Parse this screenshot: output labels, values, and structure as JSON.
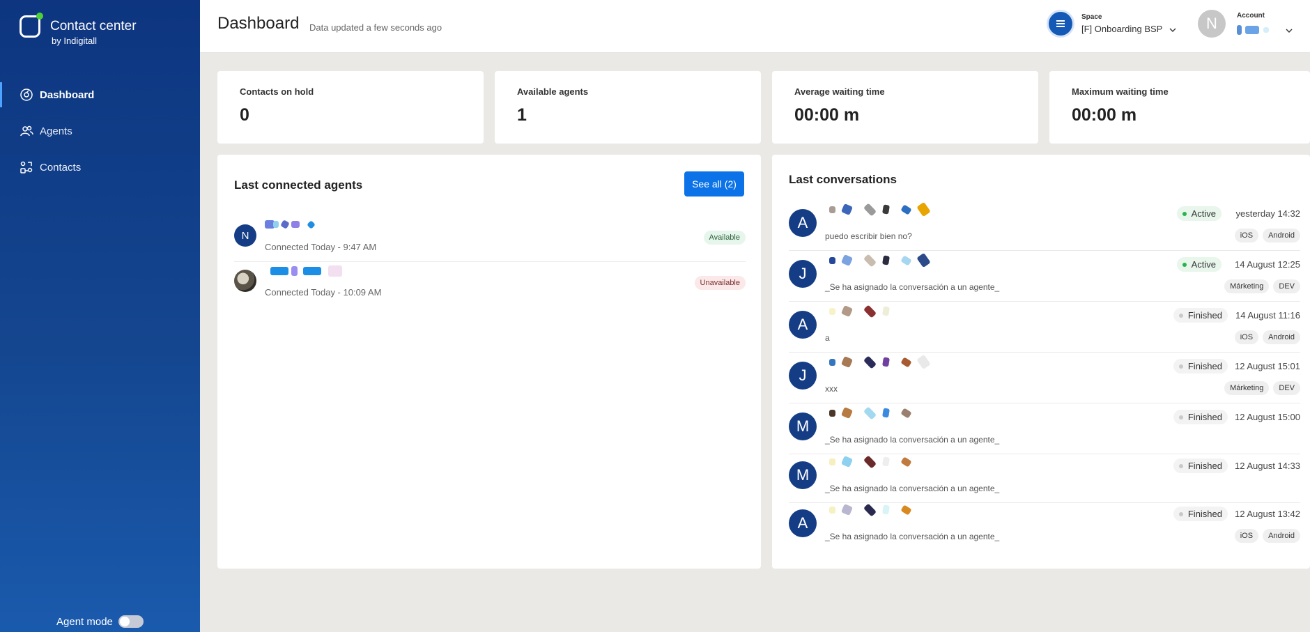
{
  "brand": {
    "title": "Contact center",
    "subtitle": "by Indigitall"
  },
  "nav": [
    {
      "label": "Dashboard",
      "icon": "dashboard-icon",
      "active": true
    },
    {
      "label": "Agents",
      "icon": "agents-icon",
      "active": false
    },
    {
      "label": "Contacts",
      "icon": "contacts-icon",
      "active": false
    }
  ],
  "agent_mode": {
    "label": "Agent mode",
    "enabled": false
  },
  "header": {
    "title": "Dashboard",
    "updated": "Data updated a few seconds ago",
    "space_label": "Space",
    "space_value": "[F] Onboarding BSP",
    "account_label": "Account",
    "account_initial": "N"
  },
  "stats": [
    {
      "label": "Contacts on hold",
      "value": "0"
    },
    {
      "label": "Available agents",
      "value": "1"
    },
    {
      "label": "Average waiting time",
      "value": "00:00 m"
    },
    {
      "label": "Maximum waiting time",
      "value": "00:00 m"
    }
  ],
  "agents_panel": {
    "title": "Last connected agents",
    "see_all": "See all (2)",
    "agents": [
      {
        "initial": "N",
        "connected": "Connected Today - 9:47 AM",
        "status": "Available"
      },
      {
        "initial": "",
        "connected": "Connected Today - 10:09 AM",
        "status": "Unavailable"
      }
    ]
  },
  "conversations_panel": {
    "title": "Last conversations",
    "items": [
      {
        "initial": "A",
        "message": "puedo escribir bien no?",
        "status": "Active",
        "time": "yesterday 14:32",
        "tags": [
          "iOS",
          "Android"
        ]
      },
      {
        "initial": "J",
        "message": "_Se ha asignado la conversación a un agente_",
        "status": "Active",
        "time": "14 August 12:25",
        "tags": [
          "Márketing",
          "DEV"
        ]
      },
      {
        "initial": "A",
        "message": "a",
        "status": "Finished",
        "time": "14 August 11:16",
        "tags": [
          "iOS",
          "Android"
        ]
      },
      {
        "initial": "J",
        "message": "xxx",
        "status": "Finished",
        "time": "12 August 15:01",
        "tags": [
          "Márketing",
          "DEV"
        ]
      },
      {
        "initial": "M",
        "message": "_Se ha asignado la conversación a un agente_",
        "status": "Finished",
        "time": "12 August 15:00",
        "tags": []
      },
      {
        "initial": "M",
        "message": "_Se ha asignado la conversación a un agente_",
        "status": "Finished",
        "time": "12 August 14:33",
        "tags": []
      },
      {
        "initial": "A",
        "message": "_Se ha asignado la conversación a un agente_",
        "status": "Finished",
        "time": "12 August 13:42",
        "tags": [
          "iOS",
          "Android"
        ]
      }
    ]
  },
  "colors": {
    "sidebar": "#0d3580",
    "accent": "#0b72e7",
    "avatar": "#143d86",
    "active_dot": "#2bb24c",
    "finished_dot": "#c9c9c9"
  }
}
